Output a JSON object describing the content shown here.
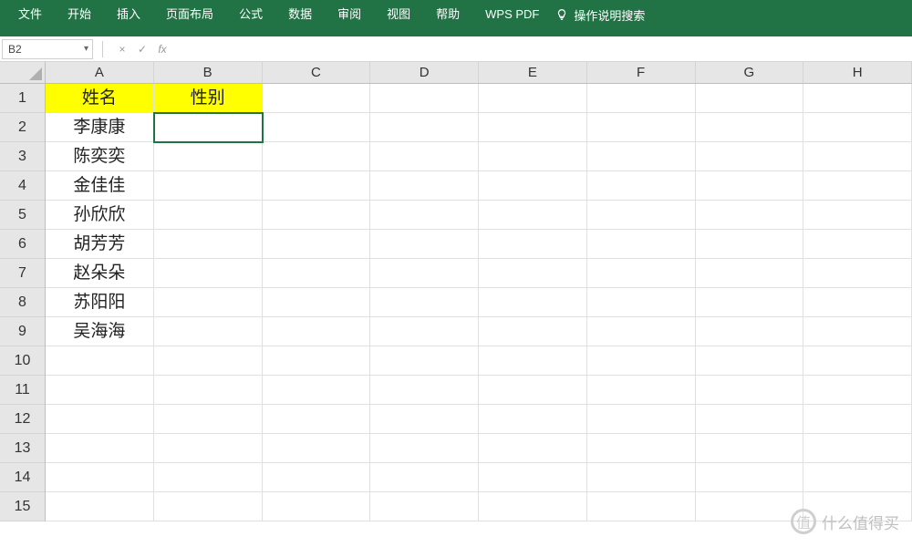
{
  "ribbon": {
    "tabs": [
      "文件",
      "开始",
      "插入",
      "页面布局",
      "公式",
      "数据",
      "审阅",
      "视图",
      "帮助",
      "WPS PDF"
    ],
    "search_hint": "操作说明搜索"
  },
  "formula_bar": {
    "name_box": "B2",
    "cancel_symbol": "×",
    "confirm_symbol": "✓",
    "fx_symbol": "fx"
  },
  "columns": [
    "A",
    "B",
    "C",
    "D",
    "E",
    "F",
    "G",
    "H"
  ],
  "rows": [
    "1",
    "2",
    "3",
    "4",
    "5",
    "6",
    "7",
    "8",
    "9",
    "10",
    "11",
    "12",
    "13",
    "14",
    "15"
  ],
  "sheet": {
    "header_row": {
      "A": "姓名",
      "B": "性别"
    },
    "data_rows": [
      {
        "A": "李康康"
      },
      {
        "A": "陈奕奕"
      },
      {
        "A": "金佳佳"
      },
      {
        "A": "孙欣欣"
      },
      {
        "A": "胡芳芳"
      },
      {
        "A": "赵朵朵"
      },
      {
        "A": "苏阳阳"
      },
      {
        "A": "吴海海"
      }
    ]
  },
  "active_cell": "B2",
  "watermark": {
    "logo": "值",
    "text": "什么值得买"
  }
}
